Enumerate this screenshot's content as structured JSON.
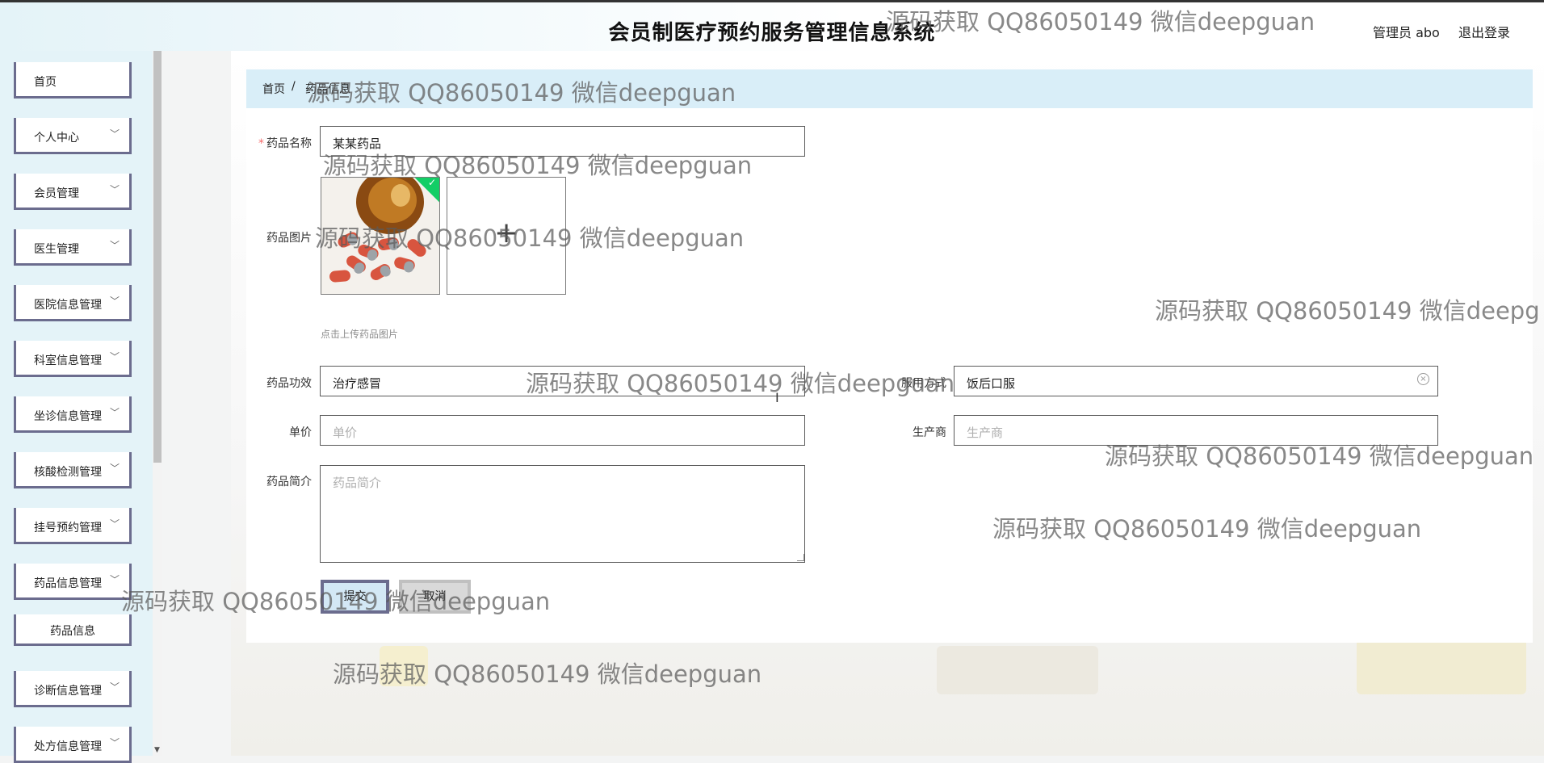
{
  "header": {
    "app_title": "会员制医疗预约服务管理信息系统",
    "user_label": "管理员 abo",
    "logout_label": "退出登录"
  },
  "sidebar": {
    "items": [
      {
        "label": "首页",
        "has_children": false
      },
      {
        "label": "个人中心",
        "has_children": true
      },
      {
        "label": "会员管理",
        "has_children": true
      },
      {
        "label": "医生管理",
        "has_children": true
      },
      {
        "label": "医院信息管理",
        "has_children": true
      },
      {
        "label": "科室信息管理",
        "has_children": true
      },
      {
        "label": "坐诊信息管理",
        "has_children": true
      },
      {
        "label": "核酸检测管理",
        "has_children": true
      },
      {
        "label": "挂号预约管理",
        "has_children": true
      },
      {
        "label": "药品信息管理",
        "has_children": true,
        "expanded": true
      },
      {
        "label": "诊断信息管理",
        "has_children": true
      },
      {
        "label": "处方信息管理",
        "has_children": true
      }
    ],
    "sub_item": "药品信息",
    "chevron": "chevron-down-icon"
  },
  "breadcrumb": {
    "home": "首页",
    "separator": "/",
    "current": "药品信息"
  },
  "form": {
    "name": {
      "label": "药品名称",
      "required": true,
      "value": "某某药品"
    },
    "image": {
      "label": "药品图片",
      "hint": "点击上传药品图片",
      "upload_icon": "plus-icon"
    },
    "efficacy": {
      "label": "药品功效",
      "value": "治疗感冒"
    },
    "usage": {
      "label": "服用方式",
      "value": "饭后口服"
    },
    "price": {
      "label": "单价",
      "placeholder": "单价"
    },
    "manufacturer": {
      "label": "生产商",
      "placeholder": "生产商"
    },
    "intro": {
      "label": "药品简介",
      "placeholder": "药品简介"
    },
    "submit_label": "提交",
    "cancel_label": "取消"
  },
  "watermark": {
    "text": "源码获取 QQ86050149 微信deepguan",
    "text_cut": "源码获取 QQ86050149 微信deepg"
  },
  "colors": {
    "accent": "#6b6c8e",
    "breadcrumb_bg": "#d9eef8",
    "required": "#f56c6c",
    "success": "#13ce66"
  }
}
